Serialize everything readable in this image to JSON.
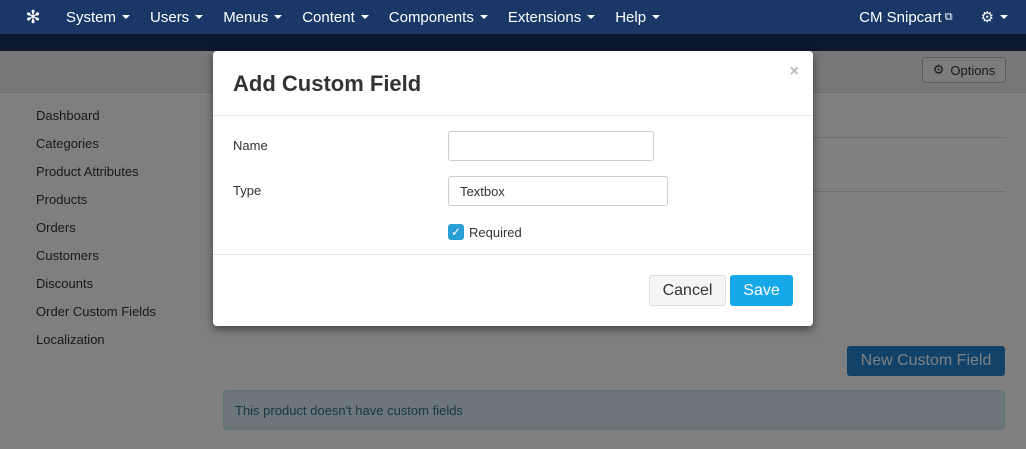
{
  "navbar": {
    "menu": [
      "System",
      "Users",
      "Menus",
      "Content",
      "Components",
      "Extensions",
      "Help"
    ],
    "site_name": "CM Snipcart"
  },
  "toolbar": {
    "options_label": "Options"
  },
  "sidebar": {
    "items": [
      "Dashboard",
      "Categories",
      "Product Attributes",
      "Products",
      "Orders",
      "Customers",
      "Discounts",
      "Order Custom Fields",
      "Localization"
    ]
  },
  "content": {
    "new_button_label": "New Custom Field",
    "empty_message": "This product doesn't have custom fields"
  },
  "modal": {
    "title": "Add Custom Field",
    "close_glyph": "×",
    "name_label": "Name",
    "name_value": "",
    "type_label": "Type",
    "type_value": "Textbox",
    "required_label": "Required",
    "required_checked": true,
    "cancel_label": "Cancel",
    "save_label": "Save"
  },
  "colors": {
    "navbar": "#1a3867",
    "save": "#16a8e8",
    "new_button": "#2384d3",
    "alert_bg": "#d9edf7"
  }
}
